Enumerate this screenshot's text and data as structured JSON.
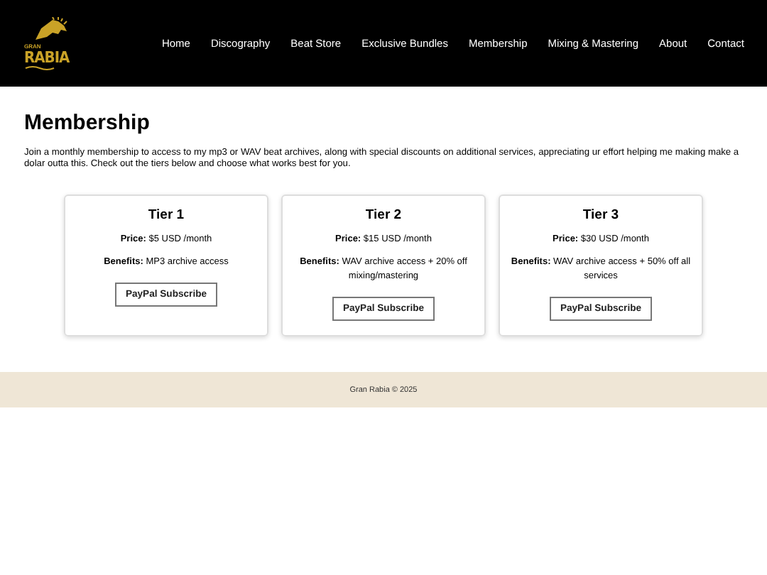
{
  "logo": {
    "small": "GRAN",
    "big": "RABIA"
  },
  "nav": [
    "Home",
    "Discography",
    "Beat Store",
    "Exclusive Bundles",
    "Membership",
    "Mixing & Mastering",
    "About",
    "Contact"
  ],
  "heading": "Membership",
  "intro": "Join a monthly membership to access to my mp3 or WAV beat archives, along with special discounts on additional services, appreciating ur effort helping me making make a dolar outta this. Check out the tiers below and choose what works best for you.",
  "tiers": [
    {
      "title": "Tier 1",
      "price": "**Price:** $5 USD /month",
      "benefits": "**Benefits:** MP3 archive access",
      "button": "PayPal Subscribe"
    },
    {
      "title": "Tier 2",
      "price": "**Price:** $15 USD /month",
      "benefits": "**Benefits:** WAV archive access + 20% off mixing/mastering",
      "button": "PayPal Subscribe"
    },
    {
      "title": "Tier 3",
      "price": "**Price:** $30 USD /month",
      "benefits": "**Benefits:** WAV archive access + 50% off all services",
      "button": "PayPal Subscribe"
    }
  ],
  "footer": "Gran Rabia © 2025"
}
